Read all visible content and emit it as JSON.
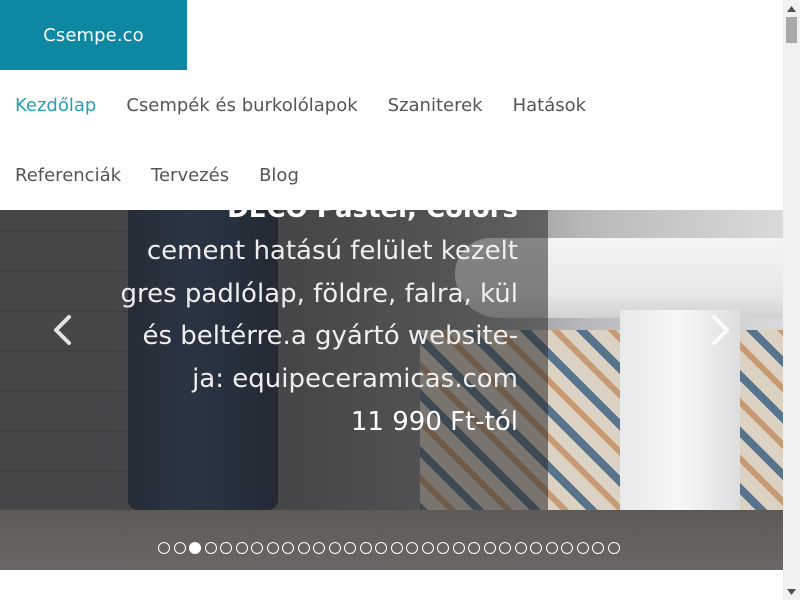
{
  "brand": {
    "logo_text": "Csempe.co",
    "accent_color": "#0e87a3"
  },
  "nav": {
    "row1": [
      {
        "label": "Kezdőlap",
        "active": true
      },
      {
        "label": "Csempék és burkolólapok",
        "active": false
      },
      {
        "label": "Szaniterek",
        "active": false
      },
      {
        "label": "Hatások",
        "active": false
      }
    ],
    "row2": [
      {
        "label": "Referenciák",
        "active": false
      },
      {
        "label": "Tervezés",
        "active": false
      },
      {
        "label": "Blog",
        "active": false
      }
    ]
  },
  "slider": {
    "title": "DECO Pastel, Colors",
    "description": "cement hatású felület kezelt gres padlólap, földre, falra, kül és beltérre.a gyártó website-ja: equipeceramicas.com",
    "price": "11 990 Ft-tól",
    "prev_icon": "chevron-left-icon",
    "next_icon": "chevron-right-icon",
    "dot_count": 30,
    "active_dot": 3
  }
}
